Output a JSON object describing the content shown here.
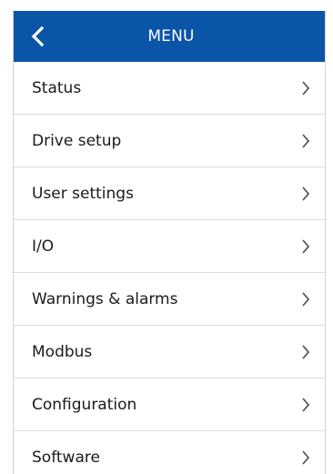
{
  "header": {
    "title": "MENU",
    "back_icon": "chevron-left-icon",
    "background_color": "#0a55a8",
    "text_color": "#ffffff"
  },
  "menu": {
    "items": [
      {
        "label": "Status",
        "icon": "chevron-right-icon"
      },
      {
        "label": "Drive setup",
        "icon": "chevron-right-icon"
      },
      {
        "label": "User settings",
        "icon": "chevron-right-icon"
      },
      {
        "label": "I/O",
        "icon": "chevron-right-icon"
      },
      {
        "label": "Warnings & alarms",
        "icon": "chevron-right-icon"
      },
      {
        "label": "Modbus",
        "icon": "chevron-right-icon"
      },
      {
        "label": "Configuration",
        "icon": "chevron-right-icon"
      },
      {
        "label": "Software",
        "icon": "chevron-right-icon"
      }
    ]
  }
}
